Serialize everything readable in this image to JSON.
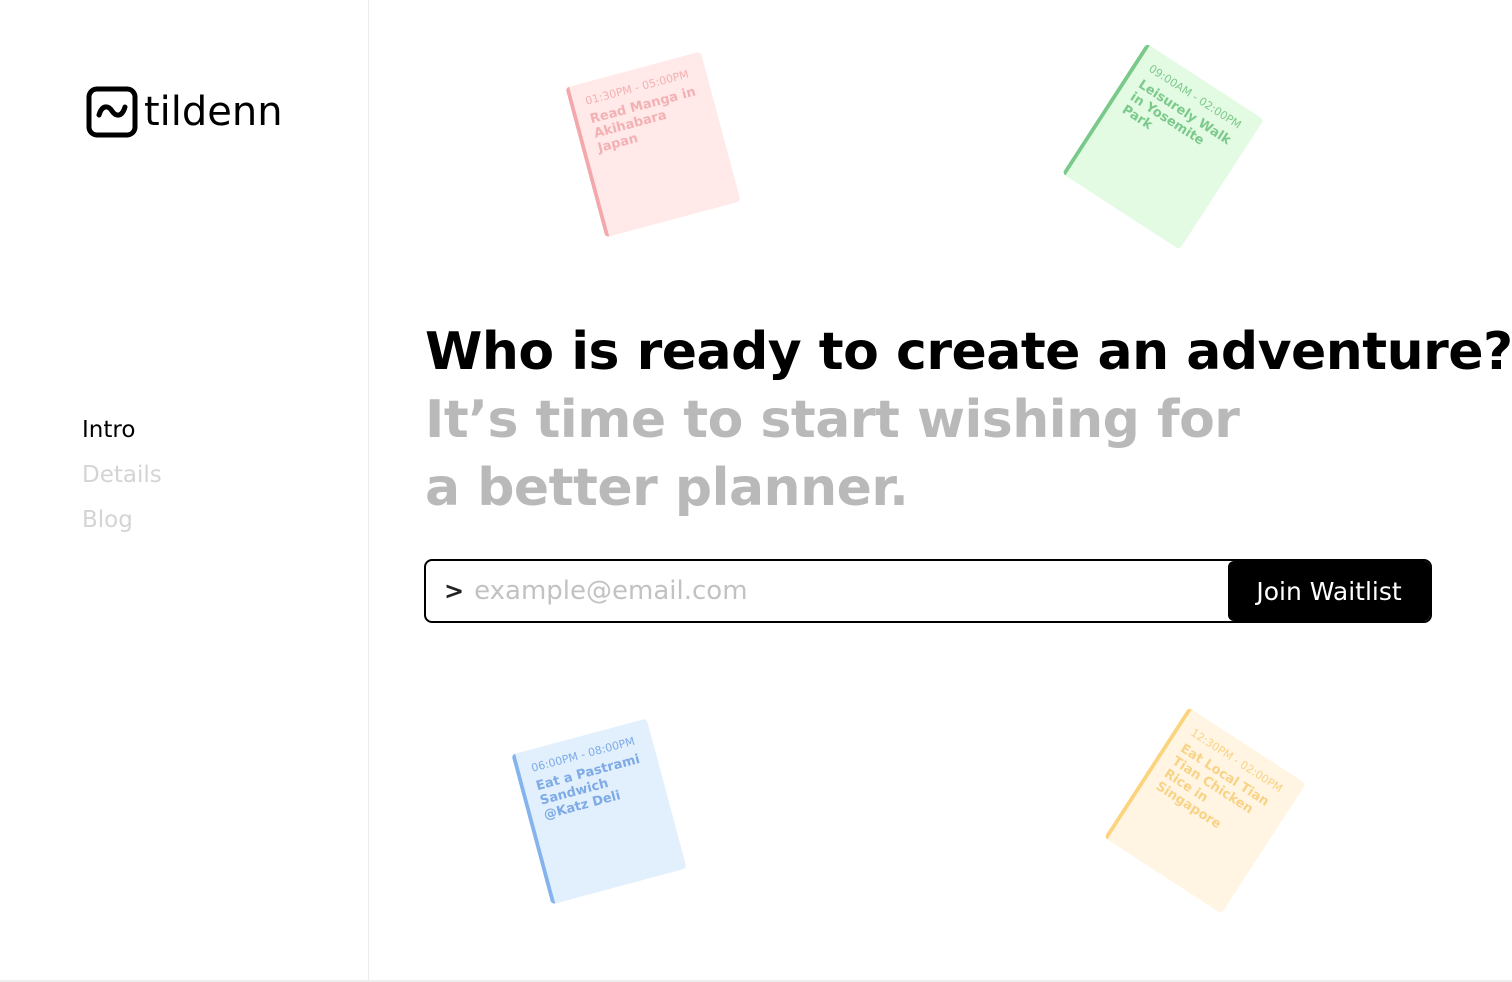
{
  "brand": {
    "name": "tildenn",
    "logo_icon": "tilde-box-icon"
  },
  "nav": {
    "items": [
      {
        "label": "Intro",
        "active": true
      },
      {
        "label": "Details",
        "active": false
      },
      {
        "label": "Blog",
        "active": false
      }
    ]
  },
  "hero": {
    "headline": "Who is ready to create an adventure?",
    "subheadline": "It’s time to start wishing for a better planner."
  },
  "signup": {
    "prompt": ">",
    "placeholder": "example@email.com",
    "value": "",
    "button_label": "Join Waitlist"
  },
  "cards": [
    {
      "time": "01:30PM - 05:00PM",
      "title": "Read Manga in Akihabara Japan",
      "color": "#ffe9e9",
      "accent": "#f3a8ac"
    },
    {
      "time": "09:00AM - 02:00PM",
      "title": "Leisurely Walk in Yosemite Park",
      "color": "#e3fbe3",
      "accent": "#79c98a"
    },
    {
      "time": "06:00PM - 08:00PM",
      "title": "Eat a Pastrami Sandwich @Katz Deli",
      "color": "#e2f0fd",
      "accent": "#84b3ee"
    },
    {
      "time": "12:30PM - 02:00PM",
      "title": "Eat Local Tian Tian Chicken Rice in Singapore",
      "color": "#fff5e2",
      "accent": "#fbd47d"
    }
  ],
  "colors": {
    "primary": "#000000",
    "muted_text": "#b9b9b9",
    "inactive_nav": "#d4d4d4",
    "background": "#ffffff"
  }
}
